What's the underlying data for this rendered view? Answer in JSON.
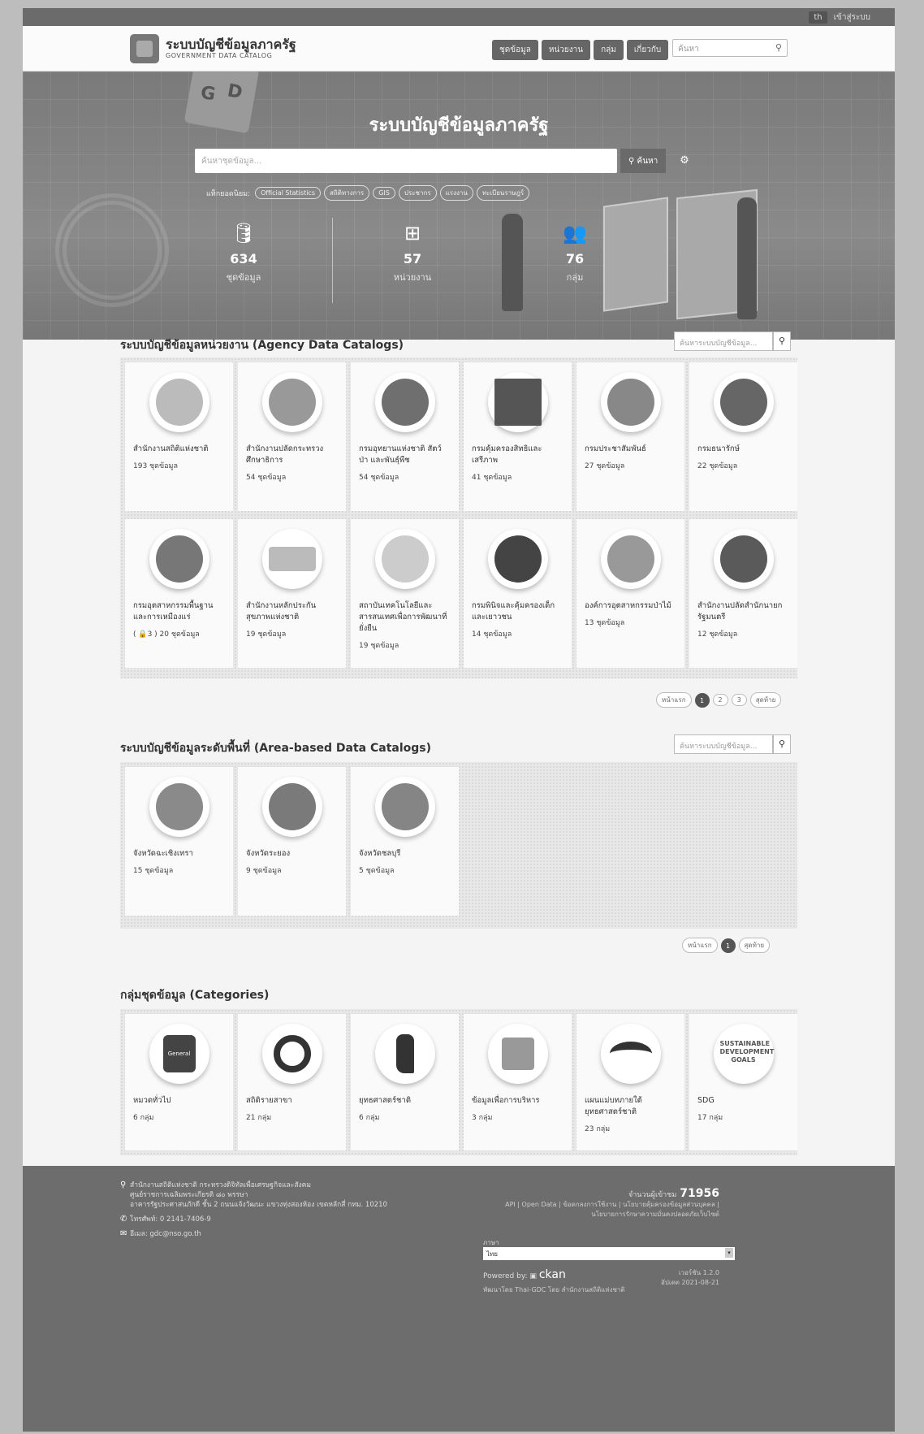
{
  "topbar": {
    "lang": "th",
    "login": "เข้าสู่ระบบ"
  },
  "header": {
    "brand_th": "ระบบบัญชีข้อมูลภาครัฐ",
    "brand_en": "GOVERNMENT DATA CATALOG",
    "nav": [
      "ชุดข้อมูล",
      "หน่วยงาน",
      "กลุ่ม",
      "เกี่ยวกับ"
    ],
    "search_placeholder": "ค้นหา"
  },
  "hero": {
    "cube_letters": [
      "G",
      "D"
    ],
    "title": "ระบบบัญชีข้อมูลภาครัฐ",
    "search_placeholder": "ค้นหาชุดข้อมูล...",
    "search_button": "ค้นหา",
    "popular_label": "แท็กยอดนิยม:",
    "tags": [
      "Official Statistics",
      "สถิติทางการ",
      "GIS",
      "ประชากร",
      "แรงงาน",
      "ทะเบียนราษฎร์"
    ],
    "stats": [
      {
        "icon": "database-icon",
        "number": "634",
        "caption": "ชุดข้อมูล"
      },
      {
        "icon": "sitemap-icon",
        "number": "57",
        "caption": "หน่วยงาน"
      },
      {
        "icon": "users-icon",
        "number": "76",
        "caption": "กลุ่ม"
      }
    ]
  },
  "agency": {
    "title": "ระบบบัญชีข้อมูลหน่วยงาน (Agency Data Catalogs)",
    "search_placeholder": "ค้นหาระบบบัญชีข้อมูล...",
    "cards": [
      {
        "name": "สำนักงานสถิติแห่งชาติ",
        "count": "193 ชุดข้อมูล"
      },
      {
        "name": "สำนักงานปลัดกระทรวงศึกษาธิการ",
        "count": "54 ชุดข้อมูล"
      },
      {
        "name": "กรมอุทยานแห่งชาติ สัตว์ป่า และพันธุ์พืช",
        "count": "54 ชุดข้อมูล"
      },
      {
        "name": "กรมคุ้มครองสิทธิและเสรีภาพ",
        "count": "41 ชุดข้อมูล"
      },
      {
        "name": "กรมประชาสัมพันธ์",
        "count": "27 ชุดข้อมูล"
      },
      {
        "name": "กรมธนารักษ์",
        "count": "22 ชุดข้อมูล"
      },
      {
        "name": "กรมอุตสาหกรรมพื้นฐานและการเหมืองแร่",
        "count": "( 🔒3 ) 20 ชุดข้อมูล"
      },
      {
        "name": "สำนักงานหลักประกันสุขภาพแห่งชาติ",
        "count": "19 ชุดข้อมูล"
      },
      {
        "name": "สถาบันเทคโนโลยีและสารสนเทศเพื่อการพัฒนาที่ยั่งยืน",
        "count": "19 ชุดข้อมูล"
      },
      {
        "name": "กรมพินิจและคุ้มครองเด็กและเยาวชน",
        "count": "14 ชุดข้อมูล"
      },
      {
        "name": "องค์การอุตสาหกรรมป่าไม้",
        "count": "13 ชุดข้อมูล"
      },
      {
        "name": "สำนักงานปลัดสำนักนายกรัฐมนตรี",
        "count": "12 ชุดข้อมูล"
      }
    ],
    "pager": {
      "first": "หน้าแรก",
      "pages": [
        "1",
        "2",
        "3"
      ],
      "last": "สุดท้าย"
    }
  },
  "area": {
    "title": "ระบบบัญชีข้อมูลระดับพื้นที่ (Area-based Data Catalogs)",
    "search_placeholder": "ค้นหาระบบบัญชีข้อมูล...",
    "cards": [
      {
        "name": "จังหวัดฉะเชิงเทรา",
        "count": "15 ชุดข้อมูล"
      },
      {
        "name": "จังหวัดระยอง",
        "count": "9 ชุดข้อมูล"
      },
      {
        "name": "จังหวัดชลบุรี",
        "count": "5 ชุดข้อมูล"
      }
    ],
    "pager": {
      "first": "หน้าแรก",
      "pages": [
        "1"
      ],
      "last": "สุดท้าย"
    }
  },
  "categories": {
    "title": "กลุ่มชุดข้อมูล (Categories)",
    "cards": [
      {
        "name": "หมวดทั่วไป",
        "count": "6 กลุ่ม",
        "icon_text": "General"
      },
      {
        "name": "สถิติรายสาขา",
        "count": "21 กลุ่ม",
        "icon_text": ""
      },
      {
        "name": "ยุทธศาสตร์ชาติ",
        "count": "6 กลุ่ม",
        "icon_text": ""
      },
      {
        "name": "ข้อมูลเพื่อการบริหาร",
        "count": "3 กลุ่ม",
        "icon_text": ""
      },
      {
        "name": "แผนแม่บทภายใต้ยุทธศาสตร์ชาติ",
        "count": "23 กลุ่ม",
        "icon_text": ""
      },
      {
        "name": "SDG",
        "count": "17 กลุ่ม",
        "icon_text": "SUSTAINABLE DEVELOPMENT GOALS"
      }
    ]
  },
  "footer": {
    "address_1": "สำนักงานสถิติแห่งชาติ กระทรวงดิจิทัลเพื่อเศรษฐกิจและสังคม",
    "address_2": "ศูนย์ราชการเฉลิมพระเกียรติ ๘๐ พรรษา",
    "address_3": "อาคารรัฐประศาสนภักดี ชั้น 2 ถนนแจ้งวัฒนะ แขวงทุ่งสองห้อง เขตหลักสี่ กทม. 10210",
    "phone": "โทรศัพท์: 0 2141-7406-9",
    "email": "อีเมล: gdc@nso.go.th",
    "visits_label": "จำนวนผู้เข้าชม",
    "visits": "71956",
    "links_1": "API | Open Data | ข้อตกลงการใช้งาน | นโยบายคุ้มครองข้อมูลส่วนบุคคล |",
    "links_2": "นโยบายการรักษาความมั่นคงปลอดภัยเว็บไซต์",
    "lang_label": "ภาษา",
    "lang_value": "ไทย",
    "powered_label": "Powered by:",
    "powered_brand": "ckan",
    "dev": "พัฒนาโดย Thai-GDC โดย สำนักงานสถิติแห่งชาติ",
    "version_1": "เวอร์ชัน 1.2.0",
    "version_2": "อัปเดต 2021-08-21"
  }
}
